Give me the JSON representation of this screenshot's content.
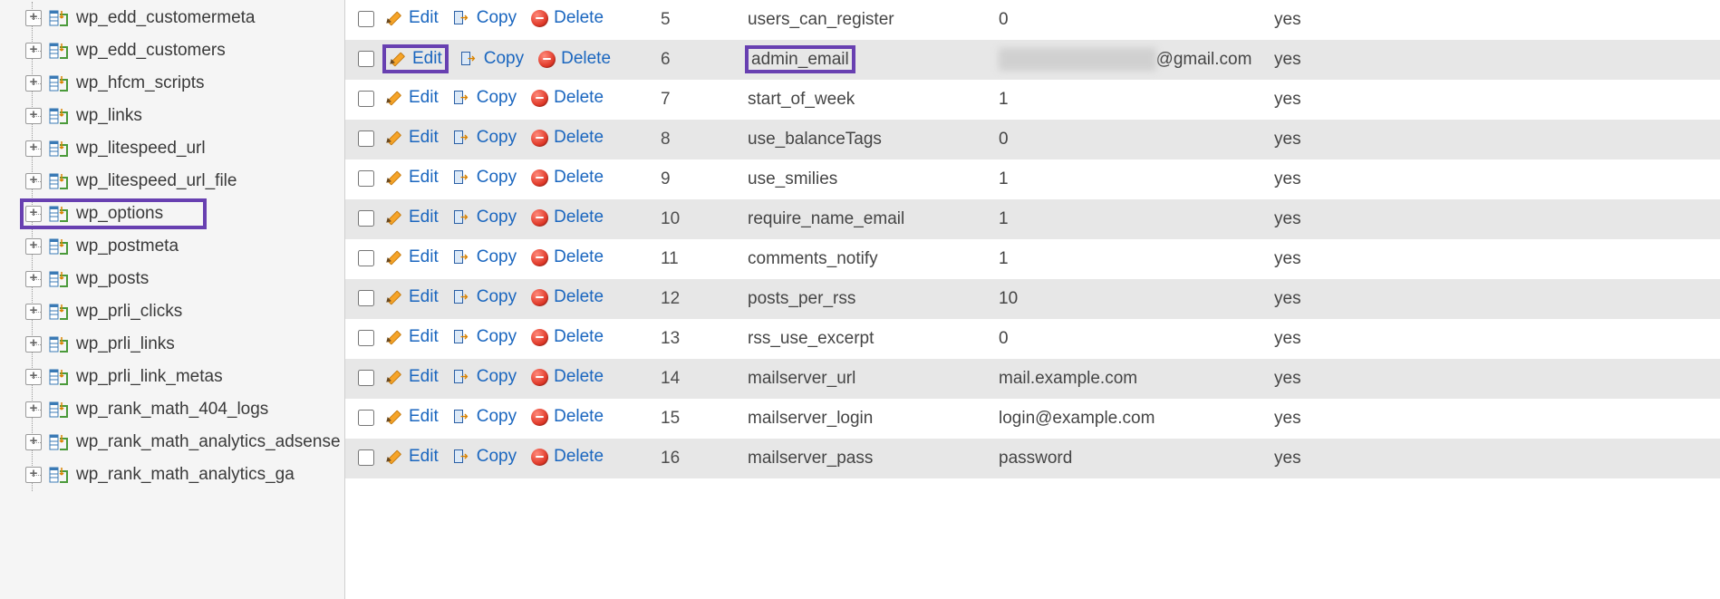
{
  "sidebar": {
    "items": [
      {
        "name": "wp_edd_customermeta",
        "selected": false,
        "expandable": true
      },
      {
        "name": "wp_edd_customers",
        "selected": false,
        "expandable": true
      },
      {
        "name": "wp_hfcm_scripts",
        "selected": false,
        "expandable": true
      },
      {
        "name": "wp_links",
        "selected": false,
        "expandable": true
      },
      {
        "name": "wp_litespeed_url",
        "selected": false,
        "expandable": true
      },
      {
        "name": "wp_litespeed_url_file",
        "selected": false,
        "expandable": true
      },
      {
        "name": "wp_options",
        "selected": true,
        "expandable": true
      },
      {
        "name": "wp_postmeta",
        "selected": false,
        "expandable": true
      },
      {
        "name": "wp_posts",
        "selected": false,
        "expandable": true
      },
      {
        "name": "wp_prli_clicks",
        "selected": false,
        "expandable": true
      },
      {
        "name": "wp_prli_links",
        "selected": false,
        "expandable": true
      },
      {
        "name": "wp_prli_link_metas",
        "selected": false,
        "expandable": true
      },
      {
        "name": "wp_rank_math_404_logs",
        "selected": false,
        "expandable": true
      },
      {
        "name": "wp_rank_math_analytics_adsense",
        "selected": false,
        "expandable": true
      },
      {
        "name": "wp_rank_math_analytics_ga",
        "selected": false,
        "expandable": true
      }
    ]
  },
  "actions": {
    "edit": "Edit",
    "copy": "Copy",
    "delete": "Delete"
  },
  "rows": [
    {
      "id": "5",
      "option_name": "users_can_register",
      "option_value": "0",
      "autoload": "yes",
      "highlight": false,
      "blurvalue": false
    },
    {
      "id": "6",
      "option_name": "admin_email",
      "option_value": "@gmail.com",
      "autoload": "yes",
      "highlight": true,
      "blurvalue": true
    },
    {
      "id": "7",
      "option_name": "start_of_week",
      "option_value": "1",
      "autoload": "yes",
      "highlight": false,
      "blurvalue": false
    },
    {
      "id": "8",
      "option_name": "use_balanceTags",
      "option_value": "0",
      "autoload": "yes",
      "highlight": false,
      "blurvalue": false
    },
    {
      "id": "9",
      "option_name": "use_smilies",
      "option_value": "1",
      "autoload": "yes",
      "highlight": false,
      "blurvalue": false
    },
    {
      "id": "10",
      "option_name": "require_name_email",
      "option_value": "1",
      "autoload": "yes",
      "highlight": false,
      "blurvalue": false
    },
    {
      "id": "11",
      "option_name": "comments_notify",
      "option_value": "1",
      "autoload": "yes",
      "highlight": false,
      "blurvalue": false
    },
    {
      "id": "12",
      "option_name": "posts_per_rss",
      "option_value": "10",
      "autoload": "yes",
      "highlight": false,
      "blurvalue": false
    },
    {
      "id": "13",
      "option_name": "rss_use_excerpt",
      "option_value": "0",
      "autoload": "yes",
      "highlight": false,
      "blurvalue": false
    },
    {
      "id": "14",
      "option_name": "mailserver_url",
      "option_value": "mail.example.com",
      "autoload": "yes",
      "highlight": false,
      "blurvalue": false
    },
    {
      "id": "15",
      "option_name": "mailserver_login",
      "option_value": "login@example.com",
      "autoload": "yes",
      "highlight": false,
      "blurvalue": false
    },
    {
      "id": "16",
      "option_name": "mailserver_pass",
      "option_value": "password",
      "autoload": "yes",
      "highlight": false,
      "blurvalue": false
    }
  ]
}
